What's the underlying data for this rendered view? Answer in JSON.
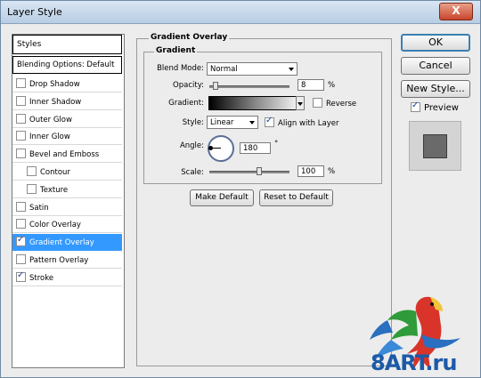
{
  "window": {
    "title": "Layer Style",
    "close_glyph": "X"
  },
  "styles_panel": {
    "header": "Styles",
    "blending_options": "Blending Options: Default",
    "items": [
      {
        "label": "Drop Shadow",
        "checked": false,
        "indent": false,
        "selected": false
      },
      {
        "label": "Inner Shadow",
        "checked": false,
        "indent": false,
        "selected": false
      },
      {
        "label": "Outer Glow",
        "checked": false,
        "indent": false,
        "selected": false
      },
      {
        "label": "Inner Glow",
        "checked": false,
        "indent": false,
        "selected": false
      },
      {
        "label": "Bevel and Emboss",
        "checked": false,
        "indent": false,
        "selected": false
      },
      {
        "label": "Contour",
        "checked": false,
        "indent": true,
        "selected": false
      },
      {
        "label": "Texture",
        "checked": false,
        "indent": true,
        "selected": false
      },
      {
        "label": "Satin",
        "checked": false,
        "indent": false,
        "selected": false
      },
      {
        "label": "Color Overlay",
        "checked": false,
        "indent": false,
        "selected": false
      },
      {
        "label": "Gradient Overlay",
        "checked": true,
        "indent": false,
        "selected": true
      },
      {
        "label": "Pattern Overlay",
        "checked": false,
        "indent": false,
        "selected": false
      },
      {
        "label": "Stroke",
        "checked": true,
        "indent": false,
        "selected": false
      }
    ]
  },
  "gradient_overlay": {
    "group_title": "Gradient Overlay",
    "subgroup_title": "Gradient",
    "blend_mode_label": "Blend Mode:",
    "blend_mode_value": "Normal",
    "opacity_label": "Opacity:",
    "opacity_value": "8",
    "opacity_fraction": 0.08,
    "percent": "%",
    "gradient_label": "Gradient:",
    "reverse_label": "Reverse",
    "reverse_checked": false,
    "style_label": "Style:",
    "style_value": "Linear",
    "align_label": "Align with Layer",
    "align_checked": true,
    "angle_label": "Angle:",
    "angle_value": "180",
    "degree": "°",
    "scale_label": "Scale:",
    "scale_value": "100",
    "scale_fraction": 0.375,
    "make_default": "Make Default",
    "reset_default": "Reset to Default"
  },
  "actions": {
    "ok": "OK",
    "cancel": "Cancel",
    "new_style": "New Style...",
    "preview_label": "Preview",
    "preview_checked": true
  },
  "watermark": {
    "text": "8ART.ru"
  },
  "colors": {
    "selection": "#3399ff",
    "title_bar": "#c8d9ea",
    "accent_border": "#3c7fb1"
  }
}
